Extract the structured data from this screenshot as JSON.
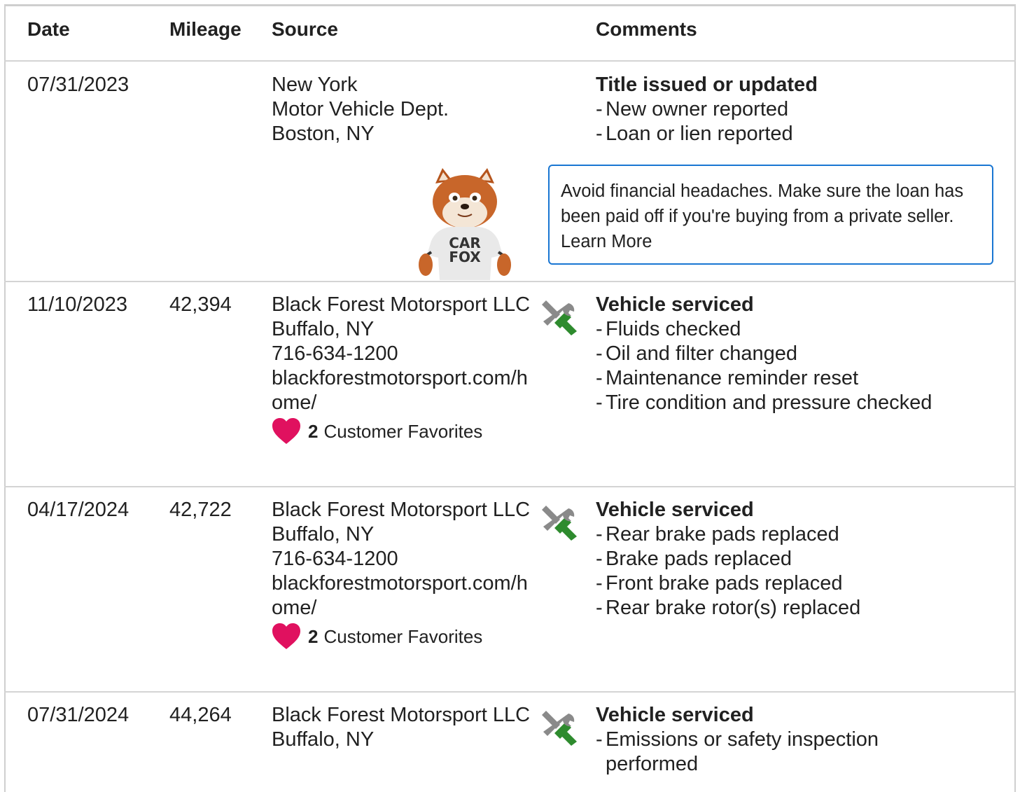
{
  "header": {
    "date": "Date",
    "mileage": "Mileage",
    "source": "Source",
    "comments": "Comments"
  },
  "rows": [
    {
      "date": "07/31/2023",
      "mileage": "",
      "source": [
        "New York",
        "Motor Vehicle Dept.",
        "Boston, NY"
      ],
      "comment_title": "Title issued or updated",
      "items": [
        "New owner reported",
        "Loan or lien reported"
      ],
      "note": "Avoid financial headaches. Make sure the loan has been paid off if you're buying from a private seller. Learn More",
      "mascot_shirt": [
        "CAR",
        "FOX"
      ]
    },
    {
      "date": "11/10/2023",
      "mileage": "42,394",
      "source": [
        "Black Forest Motorsport LLC",
        "Buffalo, NY",
        "716-634-1200",
        "blackforestmotorsport.com/home/"
      ],
      "favorites_count": "2",
      "favorites_label": "Customer Favorites",
      "icon": "service-tools-icon",
      "comment_title": "Vehicle serviced",
      "items": [
        "Fluids checked",
        "Oil and filter changed",
        "Maintenance reminder reset",
        "Tire condition and pressure checked"
      ]
    },
    {
      "date": "04/17/2024",
      "mileage": "42,722",
      "source": [
        "Black Forest Motorsport LLC",
        "Buffalo, NY",
        "716-634-1200",
        "blackforestmotorsport.com/home/"
      ],
      "favorites_count": "2",
      "favorites_label": "Customer Favorites",
      "icon": "service-tools-icon",
      "comment_title": "Vehicle serviced",
      "items": [
        "Rear brake pads replaced",
        "Brake pads replaced",
        "Front brake pads replaced",
        "Rear brake rotor(s) replaced"
      ]
    },
    {
      "date": "07/31/2024",
      "mileage": "44,264",
      "source": [
        "Black Forest Motorsport LLC",
        "Buffalo, NY"
      ],
      "icon": "service-tools-icon",
      "comment_title": "Vehicle serviced",
      "items": [
        "Emissions or safety inspection performed"
      ]
    }
  ],
  "colors": {
    "heart": "#e0115f",
    "note_border": "#1976d2",
    "wrench_green": "#2e8b2e",
    "tool_gray": "#8a8a8a"
  }
}
